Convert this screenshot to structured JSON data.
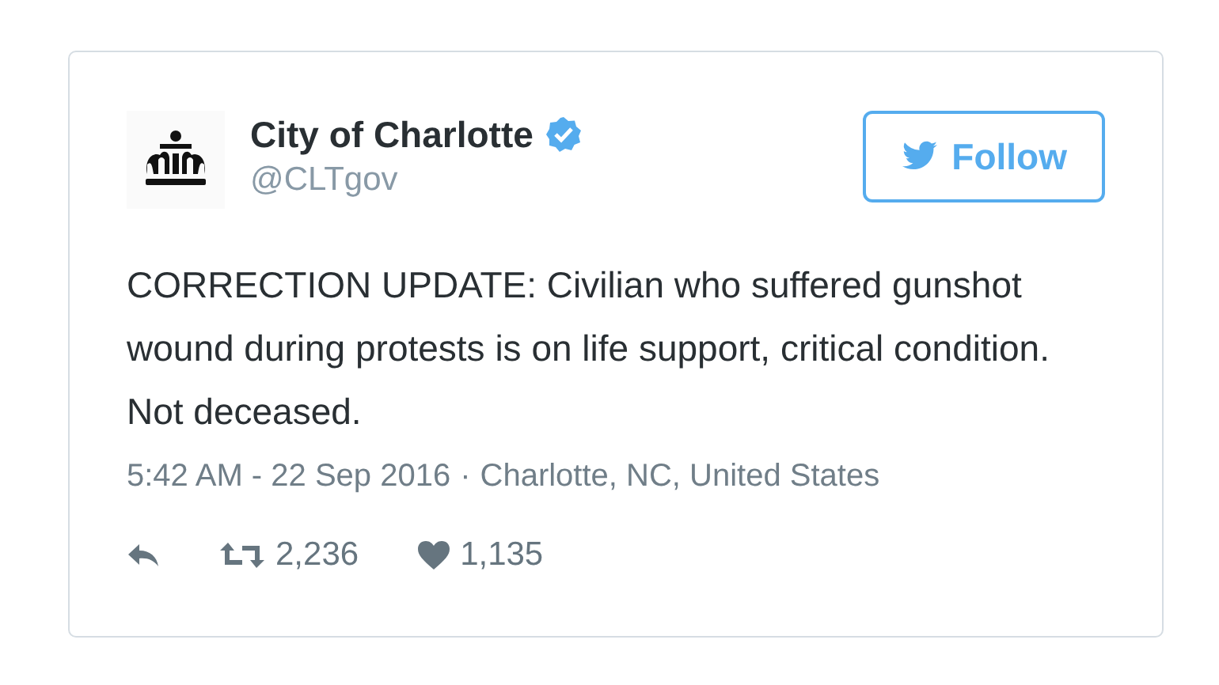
{
  "author": {
    "name": "City of Charlotte",
    "handle": "@CLTgov",
    "verified": true
  },
  "follow_button": {
    "label": "Follow"
  },
  "text": "CORRECTION UPDATE: Civilian who suffered gunshot wound during protests is on life support, critical condition. Not deceased.",
  "meta": {
    "time": "5:42 AM - 22 Sep 2016",
    "separator": "·",
    "location": "Charlotte, NC, United States"
  },
  "actions": [
    {
      "kind": "reply"
    },
    {
      "kind": "retweet",
      "count": "2,236"
    },
    {
      "kind": "like",
      "count": "1,135"
    }
  ]
}
